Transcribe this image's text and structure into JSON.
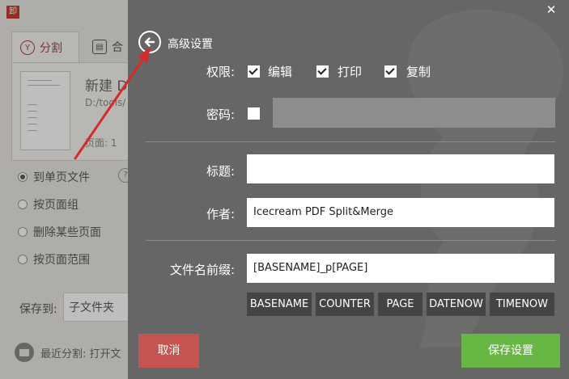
{
  "background_app": {
    "logo": "卸",
    "tabs": [
      {
        "label": "分割",
        "icon": "split-icon"
      },
      {
        "label": "合",
        "icon": "merge-icon"
      }
    ],
    "file": {
      "name": "新建 D",
      "path": "D:/tools/",
      "pages": "页面: 1"
    },
    "split_modes": [
      "到单页文件",
      "按页面组",
      "删除某些页面",
      "按页面范围"
    ],
    "help": "?",
    "save_to_label": "保存到:",
    "save_to_value": "子文件夹",
    "recent_split": "最近分割: 打开文"
  },
  "settings": {
    "title": "高级设置",
    "close": "✕",
    "permissions_label": "权限:",
    "permissions": [
      {
        "label": "编辑",
        "checked": true
      },
      {
        "label": "打印",
        "checked": true
      },
      {
        "label": "复制",
        "checked": true
      }
    ],
    "password_label": "密码:",
    "password_enabled": false,
    "title_label": "标题:",
    "title_value": "",
    "author_label": "作者:",
    "author_value": "Icecream PDF Split&Merge",
    "filename_prefix_label": "文件名前缀:",
    "filename_prefix_value": "[BASENAME]_p[PAGE]",
    "tags": [
      "BASENAME",
      "COUNTER",
      "PAGE",
      "DATENOW",
      "TIMENOW"
    ],
    "cancel": "取消",
    "save": "保存设置"
  },
  "colors": {
    "panel_bg": "#666666",
    "cancel": "#c65450",
    "save": "#68b744",
    "tag_bg": "#444444",
    "arrow": "#d62b2b"
  }
}
